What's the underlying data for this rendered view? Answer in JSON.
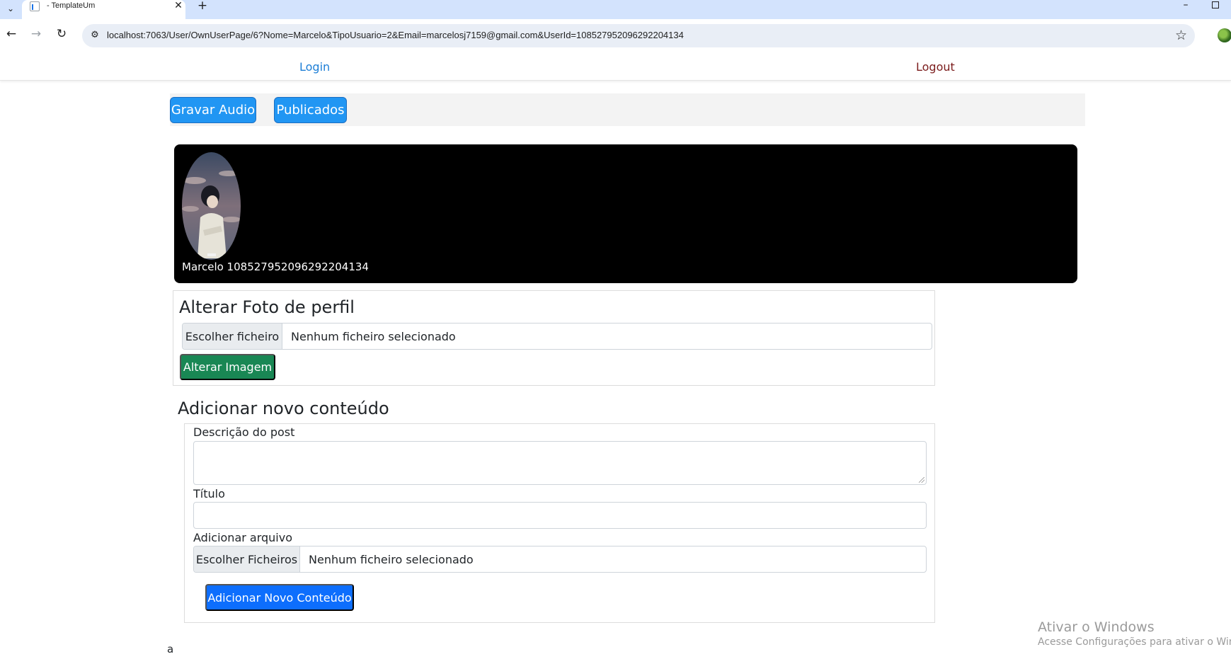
{
  "browser": {
    "tab_title": "- TemplateUm",
    "tab_close": "✕",
    "new_tab": "+",
    "url": "localhost:7063/User/OwnUserPage/6?Nome=Marcelo&TipoUsuario=2&Email=marcelosj7159@gmail.com&UserId=108527952096292204134",
    "icons": {
      "tab_list": "chevron-down-icon",
      "back": "arrow-left-icon",
      "forward": "arrow-right-icon",
      "reload": "reload-icon",
      "site_info": "tune-icon",
      "bookmark": "star-icon",
      "minimize": "minimize-icon",
      "maximize": "maximize-icon"
    }
  },
  "nav": {
    "login": "Login",
    "logout": "Logout"
  },
  "actions": {
    "record_audio": "Gravar Audio",
    "published": "Publicados"
  },
  "profile": {
    "name": "Marcelo 108527952096292204134"
  },
  "photo_section": {
    "title": "Alterar Foto de perfil",
    "file_button": "Escolher ficheiro",
    "file_status": "Nenhum ficheiro selecionado",
    "submit": "Alterar Imagem"
  },
  "content_section": {
    "title": "Adicionar novo conteúdo",
    "description_label": "Descrição do post",
    "description_value": "",
    "title_label": "Título",
    "title_value": "",
    "file_label": "Adicionar arquivo",
    "file_button": "Escolher Ficheiros",
    "file_status": "Nenhum ficheiro selecionado",
    "submit": "Adicionar Novo Conteúdo"
  },
  "footer": {
    "text": "a"
  },
  "windows_watermark": {
    "title": "Ativar o Windows",
    "subtitle": "Acesse Configurações para ativar o Windows."
  },
  "colors": {
    "tabbar_bg": "#d3e3fd",
    "omnibox_bg": "#e9eef6",
    "link_blue": "#1c7ed6",
    "logout_red": "#7b1c1c",
    "pill_blue": "#2196f3",
    "success_green": "#198754",
    "primary_blue": "#0d6efd",
    "profile_card_bg": "#000000"
  }
}
